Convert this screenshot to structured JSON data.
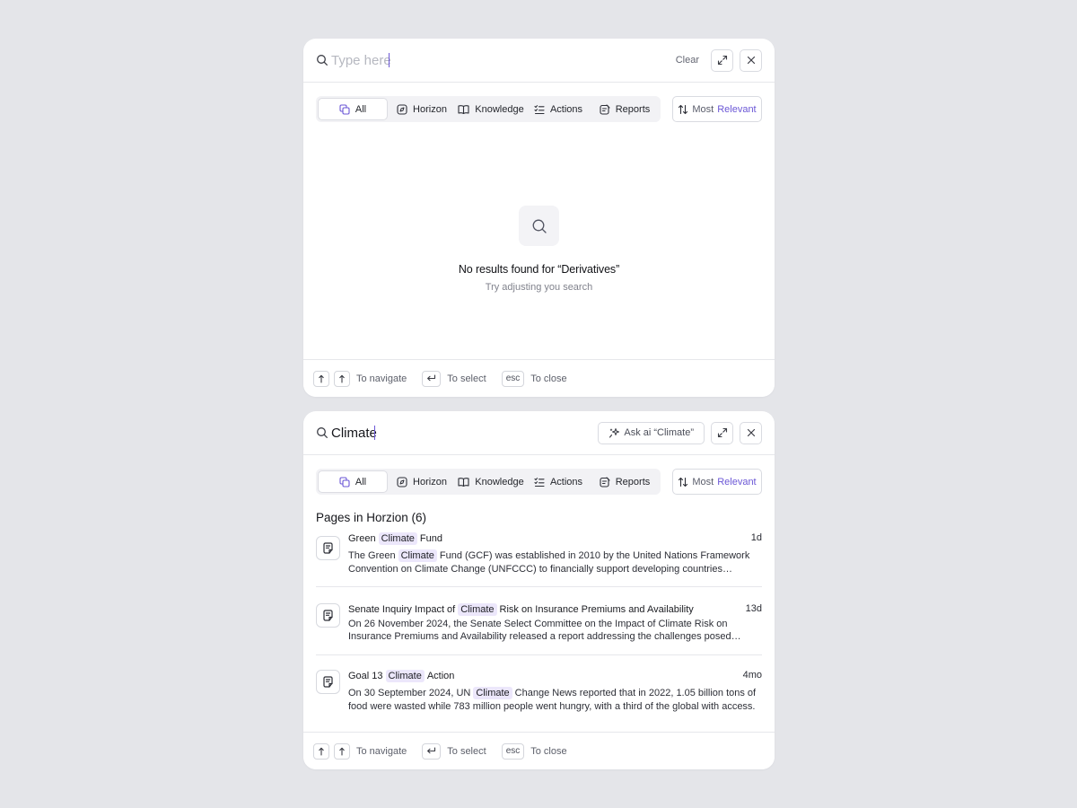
{
  "theme": {
    "accent": "#6b57d6",
    "highlight_bg": "#ece7fb",
    "page_bg": "#e4e5e9"
  },
  "empty_panel": {
    "search": {
      "placeholder": "Type here",
      "value": ""
    },
    "clear_label": "Clear",
    "expand_icon": "expand-icon",
    "close_icon": "close-icon",
    "tabs": [
      {
        "label": "All",
        "icon": "copy-icon",
        "active": true
      },
      {
        "label": "Horizon",
        "icon": "compass-icon"
      },
      {
        "label": "Knowledge",
        "icon": "book-icon"
      },
      {
        "label": "Actions",
        "icon": "checklist-icon"
      },
      {
        "label": "Reports",
        "icon": "report-icon"
      }
    ],
    "sort": {
      "word1": "Most",
      "word2": "Relevant"
    },
    "empty": {
      "title": "No results found for “Derivatives”",
      "subtitle": "Try adjusting you search"
    }
  },
  "results_panel": {
    "search": {
      "placeholder": "Type here",
      "value": "Climate"
    },
    "ask_label": "Ask ai “Climate”",
    "tabs": [
      {
        "label": "All",
        "icon": "copy-icon",
        "active": true
      },
      {
        "label": "Horizon",
        "icon": "compass-icon"
      },
      {
        "label": "Knowledge",
        "icon": "book-icon"
      },
      {
        "label": "Actions",
        "icon": "checklist-icon"
      },
      {
        "label": "Reports",
        "icon": "report-icon"
      }
    ],
    "sort": {
      "word1": "Most",
      "word2": "Relevant"
    },
    "section_title": "Pages in Horzion (6)",
    "results": [
      {
        "title_pre": "Green",
        "title_hl": "Climate",
        "title_post": "Fund",
        "time": "1d",
        "desc_pre": "The Green",
        "desc_hl": "Climate",
        "desc_post": "Fund (GCF) was established in 2010 by the United Nations Framework Convention on Climate Change (UNFCCC) to financially support developing countries addressing climate change."
      },
      {
        "title_pre": "Senate Inquiry Impact of",
        "title_hl": "Climate",
        "title_post": "Risk on Insurance Premiums and Availability",
        "time": "13d",
        "desc_pre": "",
        "desc_hl": "",
        "desc_post": "On 26 November 2024, the Senate Select Committee on the Impact of Climate Risk on Insurance Premiums and Availability released a report addressing the challenges posed Climate risk."
      },
      {
        "title_pre": "Goal 13",
        "title_hl": "Climate",
        "title_post": "Action",
        "time": "4mo",
        "desc_pre": "On 30 September 2024, UN",
        "desc_hl": "Climate",
        "desc_post": "Change News reported that in 2022, 1.05 billion tons of food were wasted while 783 million people went hungry, with a third of the global with access."
      }
    ]
  },
  "footer": {
    "navigate_label": "To navigate",
    "select_label": "To select",
    "esc_key": "esc",
    "close_label": "To close",
    "up_key_icon": "arrow-up-icon",
    "down_key_icon": "arrow-down-icon",
    "enter_key_icon": "enter-icon"
  }
}
